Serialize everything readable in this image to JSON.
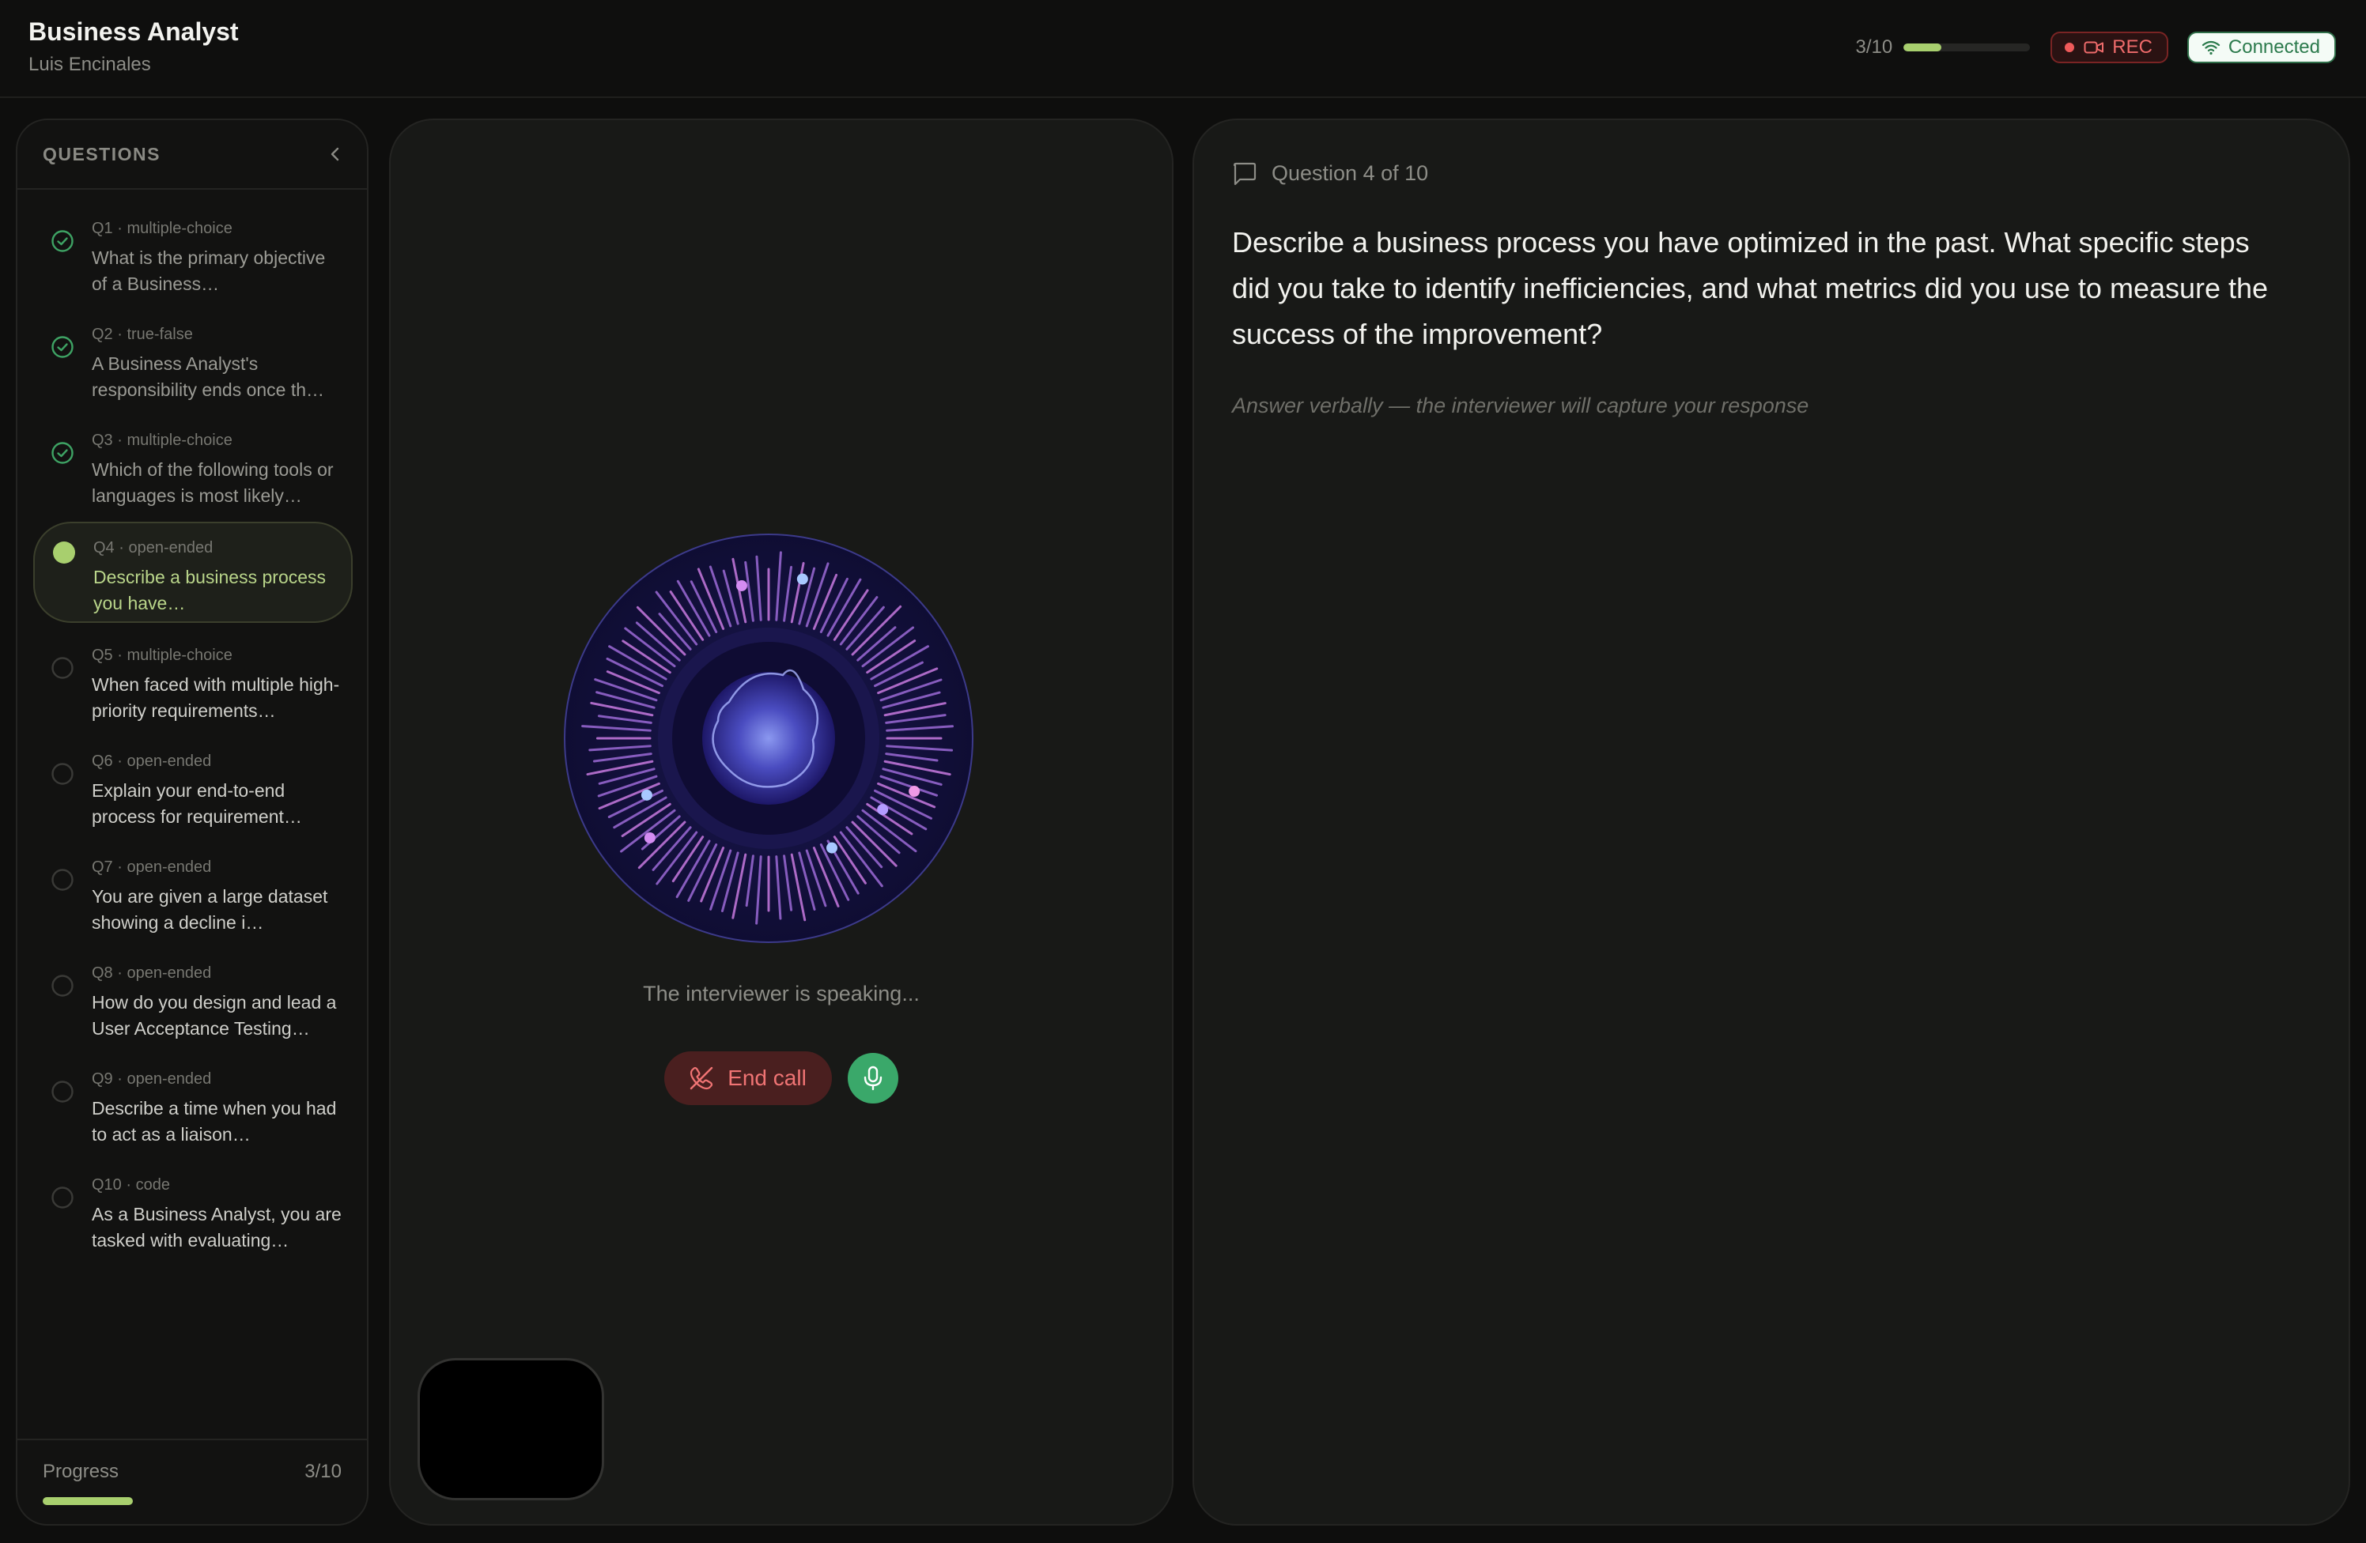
{
  "header": {
    "title": "Business Analyst",
    "subtitle": "Luis Encinales",
    "progress_text": "3/10",
    "progress_fraction": 0.3,
    "rec_label": "REC",
    "connection_label": "Connected"
  },
  "sidebar": {
    "title": "QUESTIONS",
    "questions": [
      {
        "meta": "Q1 · multiple-choice",
        "text": "What is the primary objective of a Business…",
        "status": "done"
      },
      {
        "meta": "Q2 · true-false",
        "text": "A Business Analyst's responsibility ends once th…",
        "status": "done"
      },
      {
        "meta": "Q3 · multiple-choice",
        "text": "Which of the following tools or languages is most likely…",
        "status": "done"
      },
      {
        "meta": "Q4 · open-ended",
        "text": "Describe a business process you have…",
        "status": "active"
      },
      {
        "meta": "Q5 · multiple-choice",
        "text": "When faced with multiple high-priority requirements…",
        "status": "pending"
      },
      {
        "meta": "Q6 · open-ended",
        "text": "Explain your end-to-end process for requirement…",
        "status": "pending"
      },
      {
        "meta": "Q7 · open-ended",
        "text": "You are given a large dataset showing a decline i…",
        "status": "pending"
      },
      {
        "meta": "Q8 · open-ended",
        "text": "How do you design and lead a User Acceptance Testing…",
        "status": "pending"
      },
      {
        "meta": "Q9 · open-ended",
        "text": "Describe a time when you had to act as a liaison…",
        "status": "pending"
      },
      {
        "meta": "Q10 · code",
        "text": "As a Business Analyst, you are tasked with evaluating…",
        "status": "pending"
      }
    ],
    "progress_label": "Progress",
    "progress_count": "3/10",
    "progress_fraction": 0.3
  },
  "call": {
    "status_text": "The interviewer is speaking...",
    "end_call_label": "End call"
  },
  "question_panel": {
    "header": "Question 4 of 10",
    "body": "Describe a business process you have optimized in the past. What specific steps did you take to identify inefficiencies, and what metrics did you use to measure the success of the improvement?",
    "hint": "Answer verbally — the interviewer will capture your response"
  },
  "colors": {
    "accent": "#a8cf6e",
    "done": "#3ea364",
    "rec": "#ef5a5a",
    "connected": "#2b7a4c",
    "end_call": "#f07474",
    "mic": "#3aa86a"
  },
  "icons": [
    "video-camera-icon",
    "wifi-icon",
    "chevron-left-icon",
    "check-circle-icon",
    "active-dot-icon",
    "empty-circle-icon",
    "phone-off-icon",
    "microphone-icon",
    "message-square-icon"
  ]
}
